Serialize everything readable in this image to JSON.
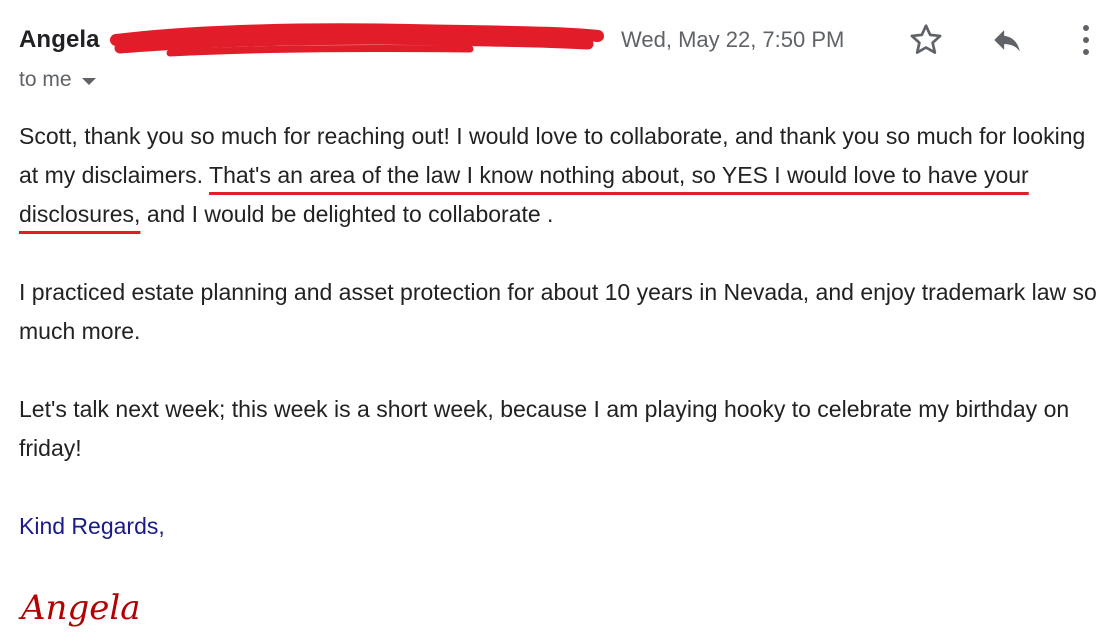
{
  "header": {
    "sender_name": "Angela",
    "date": "Wed, May 22, 7:50 PM",
    "to_label": "to me",
    "redaction_color": "#e11d2a",
    "icons": {
      "star": "star-outline-icon",
      "reply": "reply-icon",
      "more": "more-vert-icon",
      "dropdown": "caret-down-icon"
    }
  },
  "message": {
    "p1_a": "Scott, thank you so much for reaching out! I would love to collaborate, and thank you so much for looking at my disclaimers.",
    "p1_highlight": "That's an area of the law I know nothing about, so YES I would love to have your disclosures,",
    "p1_b": "and I would be delighted to collaborate .",
    "p2": "I practiced estate planning and asset protection for about 10 years in Nevada, and enjoy trademark law so much more.",
    "p3": "Let's talk next week; this week is a short week, because I am playing hooky to celebrate my birthday on friday!",
    "closing": "Kind Regards,",
    "signature": "Angela",
    "highlight_color": "#e11d2a",
    "closing_color": "#1a1a8c",
    "signature_color": "#b30000"
  }
}
